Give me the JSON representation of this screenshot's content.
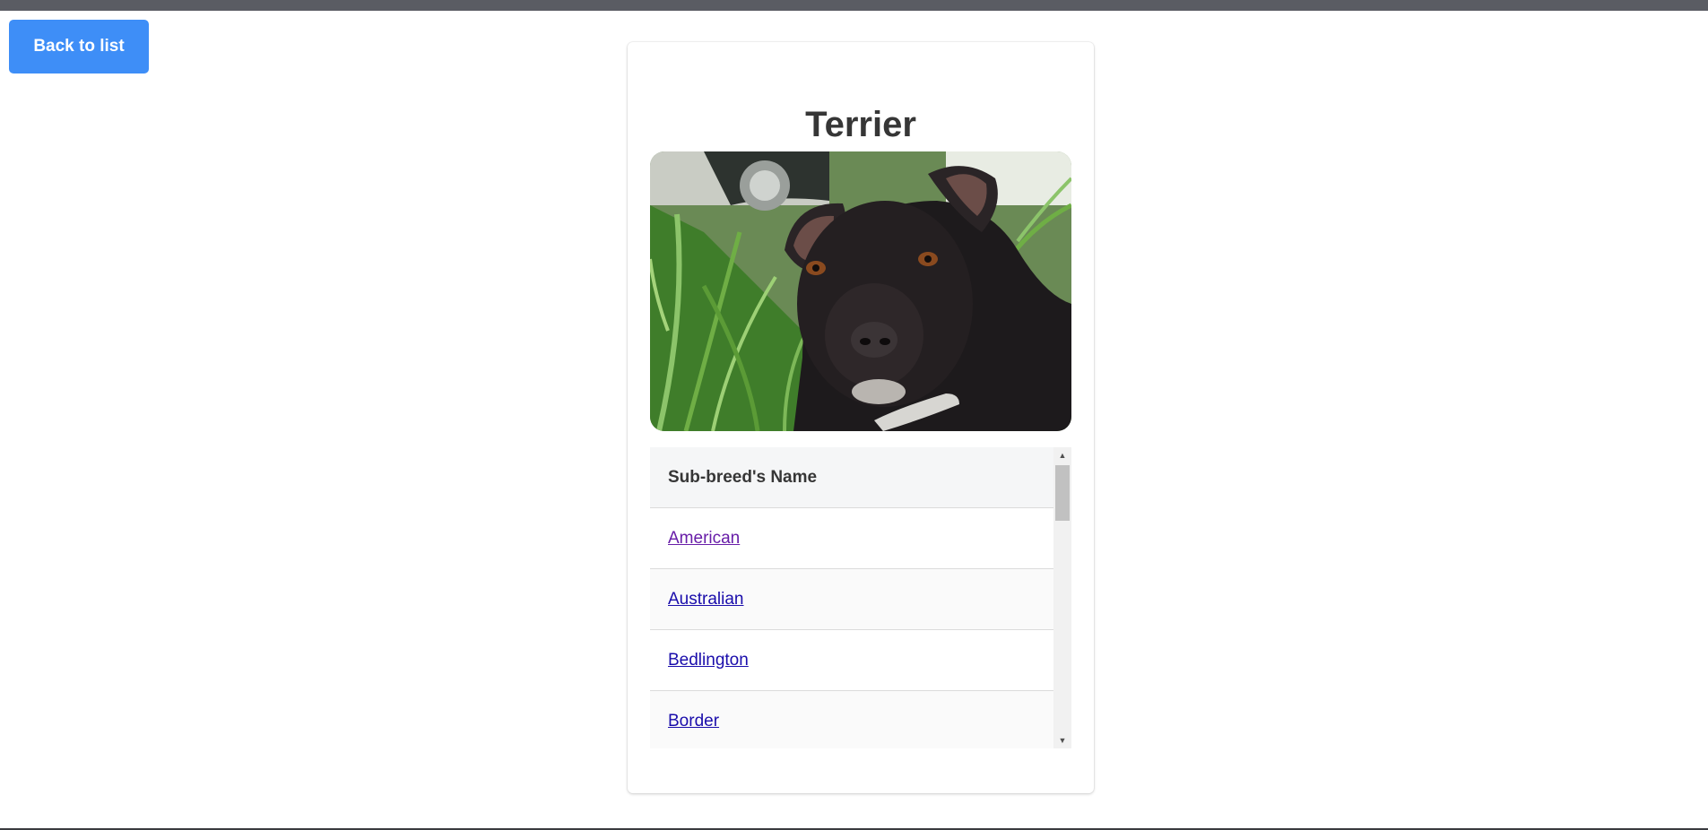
{
  "nav": {
    "back_label": "Back to list"
  },
  "breed": {
    "title": "Terrier",
    "image_alt": "Terrier"
  },
  "subbreeds": {
    "header": "Sub-breed's Name",
    "items": [
      "American",
      "Australian",
      "Bedlington",
      "Border"
    ]
  },
  "colors": {
    "accent": "#3e8ef7",
    "link": "#1a0dab",
    "visited_link": "#681da8",
    "text": "#363636"
  },
  "icons": {
    "scroll_up": "triangle-up-icon",
    "scroll_down": "triangle-down-icon"
  }
}
